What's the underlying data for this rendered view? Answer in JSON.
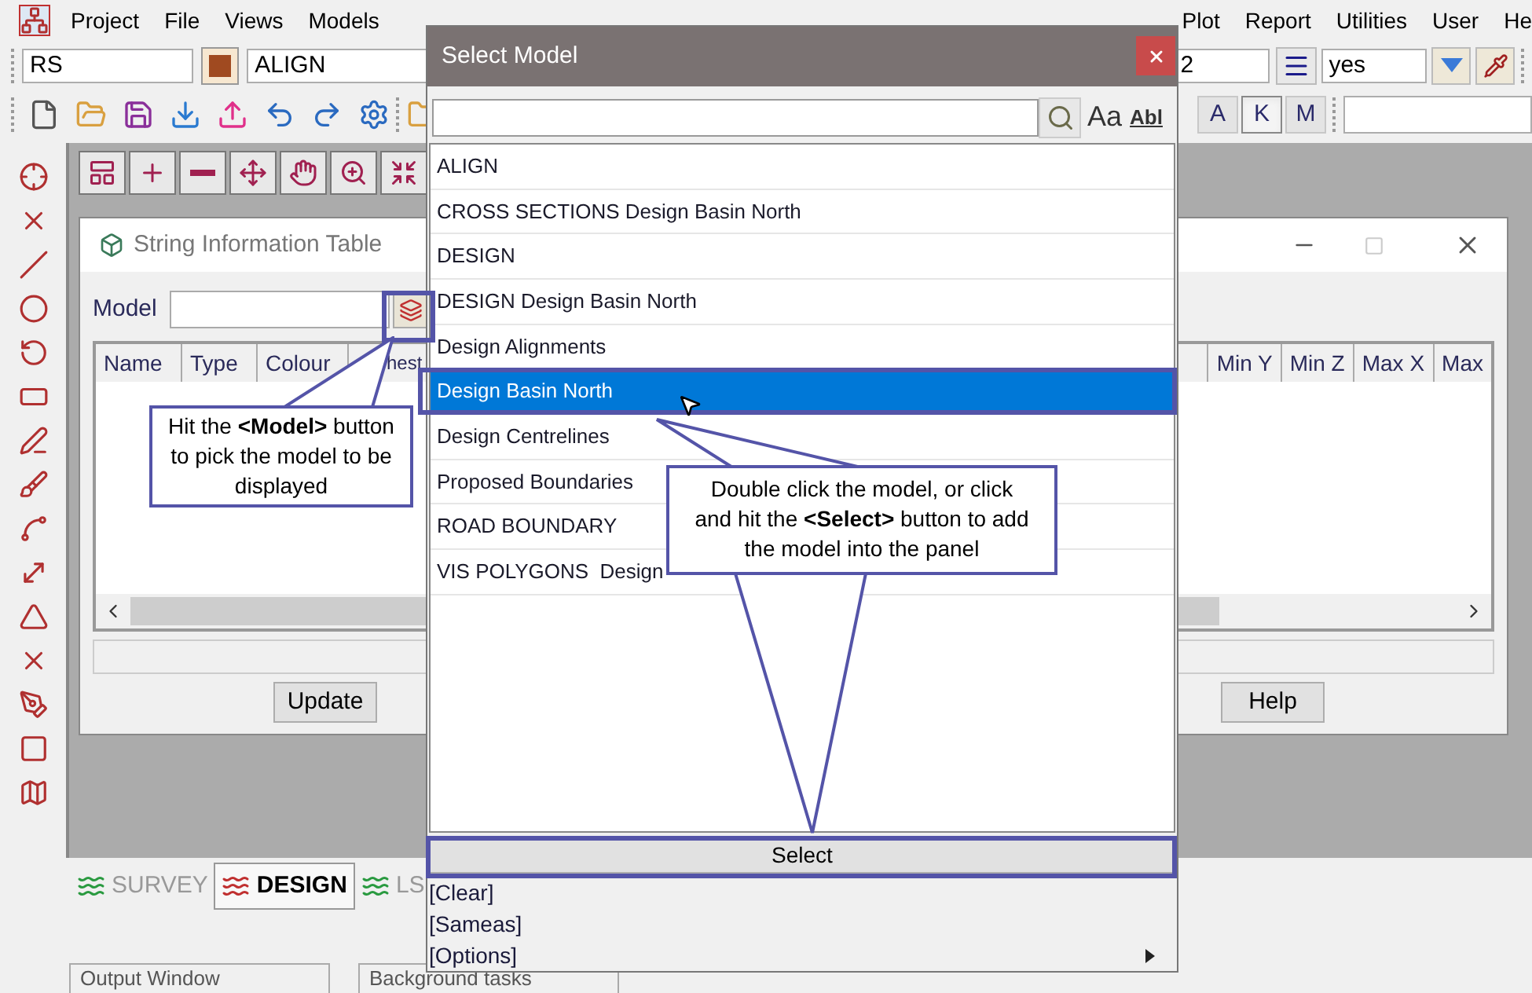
{
  "menu_bar": {
    "items_left": [
      "Project",
      "File",
      "Views",
      "Models"
    ],
    "items_right": [
      "Plot",
      "Report",
      "Utilities",
      "User",
      "He"
    ]
  },
  "toolbar": {
    "string_field": "RS",
    "model_field": "ALIGN",
    "number_field": "2",
    "choice_field": "yes",
    "mode_buttons": [
      {
        "label": "A",
        "selected": false
      },
      {
        "label": "K",
        "selected": true
      },
      {
        "label": "M",
        "selected": false
      }
    ]
  },
  "string_table": {
    "title": "String Information Table",
    "model_label": "Model",
    "columns_left": [
      "Name",
      "Type",
      "Colour",
      "hest"
    ],
    "columns_right": [
      "Min Y",
      "Min Z",
      "Max X",
      "Max"
    ],
    "buttons": [
      "Update",
      "Help"
    ]
  },
  "dialog": {
    "title": "Select Model",
    "search_options": [
      "Aa",
      "Abl"
    ],
    "items": [
      {
        "label": "ALIGN",
        "selected": false
      },
      {
        "label": "CROSS SECTIONS Design Basin North",
        "selected": false
      },
      {
        "label": "DESIGN",
        "selected": false
      },
      {
        "label": "DESIGN Design Basin North",
        "selected": false
      },
      {
        "label": "Design Alignments",
        "selected": false
      },
      {
        "label": "Design Basin North",
        "selected": true
      },
      {
        "label": "Design Centrelines",
        "selected": false
      },
      {
        "label": "Proposed Boundaries",
        "selected": false
      },
      {
        "label": "ROAD BOUNDARY",
        "selected": false
      },
      {
        "label": "VIS POLYGONS  Design",
        "selected": false
      }
    ],
    "select_button": "Select",
    "menu": [
      {
        "label": "[Clear]",
        "submenu": false
      },
      {
        "label": "[Sameas]",
        "submenu": false
      },
      {
        "label": "[Options]",
        "submenu": true
      }
    ]
  },
  "callouts": [
    {
      "text": "Hit the **<Model>** button to pick the model to be displayed"
    },
    {
      "text": "Double click the model, or click and hit the **<Select>** button to add the model into the panel"
    }
  ],
  "view_tabs": [
    {
      "label": "SURVEY",
      "selected": false
    },
    {
      "label": "DESIGN",
      "selected": true
    },
    {
      "label": "LS",
      "selected": false
    }
  ],
  "panels": [
    "Output Window",
    "Background tasks"
  ]
}
